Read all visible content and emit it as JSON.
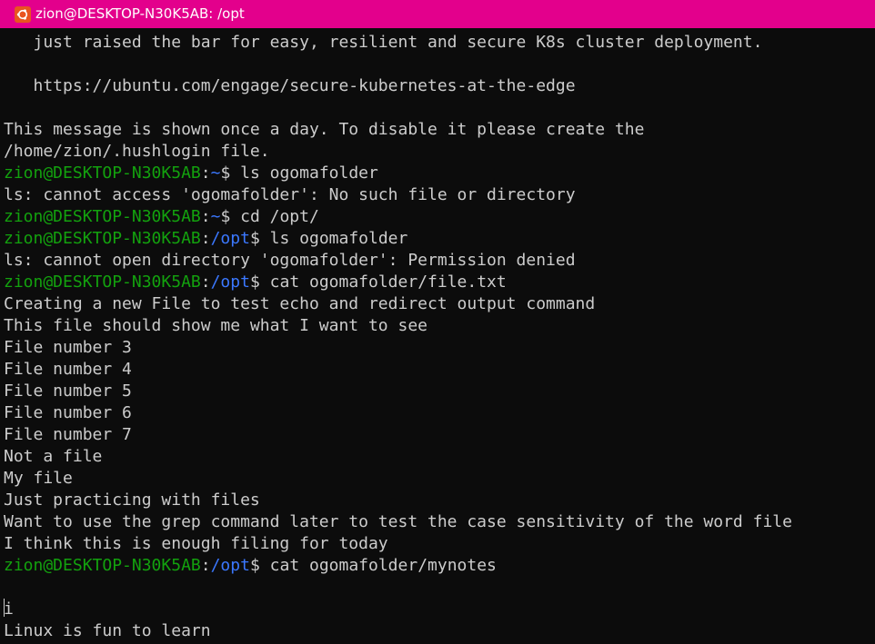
{
  "window": {
    "title": "zion@DESKTOP-N30K5AB: /opt",
    "icon": "ubuntu-icon",
    "colors": {
      "titlebar": "#e3008c",
      "background": "#0c0c0c",
      "text": "#cccccc",
      "prompt_user": "#13a10e",
      "prompt_path": "#3b78ff"
    }
  },
  "terminal": {
    "motd": {
      "line1": "   just raised the bar for easy, resilient and secure K8s cluster deployment.",
      "line2": "   https://ubuntu.com/engage/secure-kubernetes-at-the-edge",
      "line3": "This message is shown once a day. To disable it please create the",
      "line4": "/home/zion/.hushlogin file."
    },
    "prompt": {
      "user_host": "zion@DESKTOP-N30K5AB",
      "colon": ":",
      "dollar": "$ "
    },
    "sessions": [
      {
        "path": "~",
        "command": "ls ogomafolder"
      },
      {
        "path": "~",
        "command": "cd /opt/"
      },
      {
        "path": "/opt",
        "command": "ls ogomafolder"
      },
      {
        "path": "/opt",
        "command": "cat ogomafolder/file.txt"
      },
      {
        "path": "/opt",
        "command": "cat ogomafolder/mynotes"
      }
    ],
    "outputs": {
      "ls_home_error": "ls: cannot access 'ogomafolder': No such file or directory",
      "ls_opt_error": "ls: cannot open directory 'ogomafolder': Permission denied",
      "file_txt": [
        "Creating a new File to test echo and redirect output command",
        "This file should show me what I want to see",
        "File number 3",
        "File number 4",
        "File number 5",
        "File number 6",
        "File number 7",
        "Not a file",
        "My file",
        "Just practicing with files",
        "Want to use the grep command later to test the case sensitivity of the word file",
        "I think this is enough filing for today"
      ],
      "mynotes": [
        "",
        "i",
        "Linux is fun to learn"
      ]
    }
  }
}
